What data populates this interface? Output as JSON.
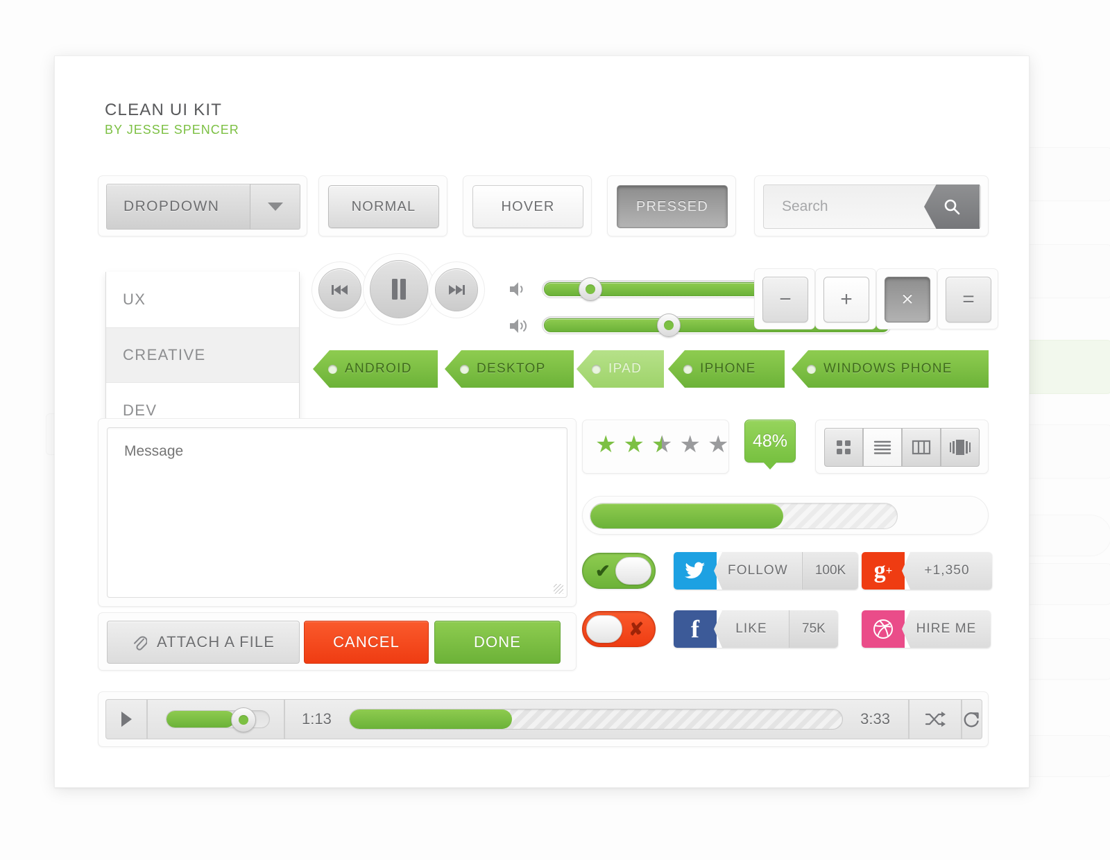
{
  "header": {
    "title": "CLEAN UI KIT",
    "subtitle": "BY JESSE SPENCER"
  },
  "dropdown": {
    "label": "DROPDOWN",
    "arrow_icon": "chevron-down-icon",
    "items": [
      {
        "label": "UX",
        "selected": false
      },
      {
        "label": "CREATIVE",
        "selected": true
      },
      {
        "label": "DEV",
        "selected": false
      }
    ]
  },
  "buttons": {
    "normal": "NORMAL",
    "hover": "HOVER",
    "pressed": "PRESSED"
  },
  "search": {
    "placeholder": "Search",
    "value": "",
    "icon": "search-icon"
  },
  "media": {
    "prev_icon": "skip-back-icon",
    "pause_icon": "pause-icon",
    "next_icon": "skip-forward-icon",
    "volume_low_icon": "speaker-low-icon",
    "volume_high_icon": "speaker-high-icon",
    "slider_top_percent": 72,
    "slider_bottom_percent": 100
  },
  "keys": {
    "minus": "−",
    "plus": "+",
    "multiply": "×",
    "equals": "=",
    "pressed_key": "multiply"
  },
  "tags": [
    {
      "label": "ANDROID",
      "state": "normal"
    },
    {
      "label": "DESKTOP",
      "state": "normal"
    },
    {
      "label": "IPAD",
      "state": "light"
    },
    {
      "label": "IPHONE",
      "state": "normal"
    },
    {
      "label": "WINDOWS PHONE",
      "state": "normal"
    }
  ],
  "message": {
    "placeholder": "Message",
    "value": ""
  },
  "actions": {
    "attach": "ATTACH A FILE",
    "attach_icon": "paperclip-icon",
    "cancel": "CANCEL",
    "done": "DONE"
  },
  "rating": {
    "value": 2.5,
    "max": 5
  },
  "percent_badge": {
    "text": "48%"
  },
  "view_toggle": {
    "options": [
      {
        "icon": "grid-view-icon",
        "active": false
      },
      {
        "icon": "list-view-icon",
        "active": true
      },
      {
        "icon": "column-view-icon",
        "active": false
      },
      {
        "icon": "coverflow-view-icon",
        "active": false
      }
    ]
  },
  "progress": {
    "percent": 48
  },
  "toggles": [
    {
      "state": "on",
      "mark_icon": "check-icon"
    },
    {
      "state": "off",
      "mark_icon": "close-icon"
    }
  ],
  "social": [
    {
      "network": "twitter",
      "icon": "twitter-icon",
      "glyph": "🐦",
      "label": "FOLLOW",
      "count": "100K",
      "color": "#1da1e2"
    },
    {
      "network": "googleplus",
      "icon": "google-plus-icon",
      "glyph": "g",
      "label": "+1,350",
      "count": "",
      "color": "#ef3c12"
    },
    {
      "network": "facebook",
      "icon": "facebook-icon",
      "glyph": "f",
      "label": "LIKE",
      "count": "75K",
      "color": "#3c5a98"
    },
    {
      "network": "dribbble",
      "icon": "dribbble-icon",
      "glyph": "◌",
      "label": "HIRE ME",
      "count": "",
      "color": "#ea4c89"
    }
  ],
  "player": {
    "play_icon": "play-icon",
    "volume_percent": 68,
    "elapsed": "1:13",
    "total": "3:33",
    "progress_percent": 36,
    "shuffle_icon": "shuffle-icon",
    "repeat_icon": "repeat-icon"
  },
  "colors": {
    "green": "#7cc043",
    "red": "#ef3c12",
    "grey_text": "#6d6e70",
    "twitter": "#1da1e2",
    "facebook": "#3c5a98",
    "googleplus": "#ef3c12",
    "dribbble": "#ea4c89"
  }
}
